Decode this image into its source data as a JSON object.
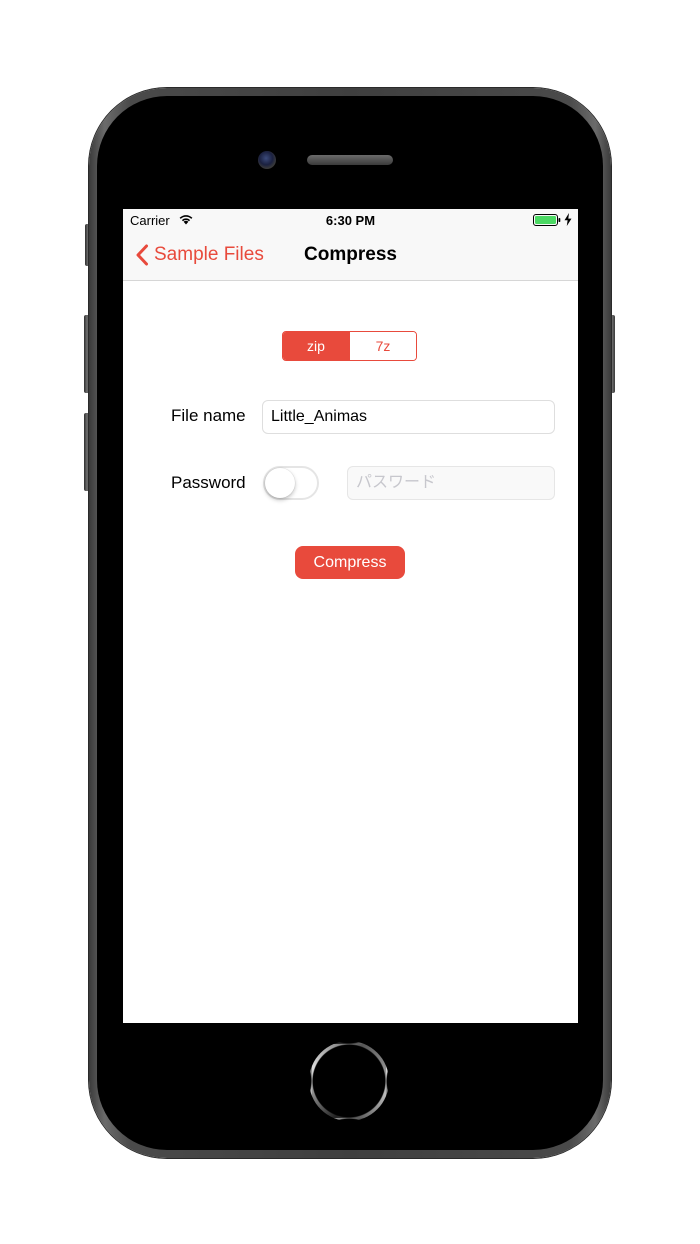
{
  "status_bar": {
    "carrier": "Carrier",
    "time": "6:30 PM",
    "icons": [
      "wifi-icon",
      "battery-icon",
      "charging-icon"
    ]
  },
  "nav": {
    "back_label": "Sample Files",
    "title": "Compress",
    "back_icon": "chevron-left-icon"
  },
  "format": {
    "options": [
      "zip",
      "7z"
    ],
    "selected": "zip"
  },
  "form": {
    "file_name_label": "File name",
    "file_name_value": "Little_Animas",
    "password_label": "Password",
    "password_enabled": false,
    "password_placeholder": "パスワード"
  },
  "actions": {
    "compress_label": "Compress"
  },
  "colors": {
    "accent": "#e84a3c",
    "battery": "#4cd964"
  }
}
